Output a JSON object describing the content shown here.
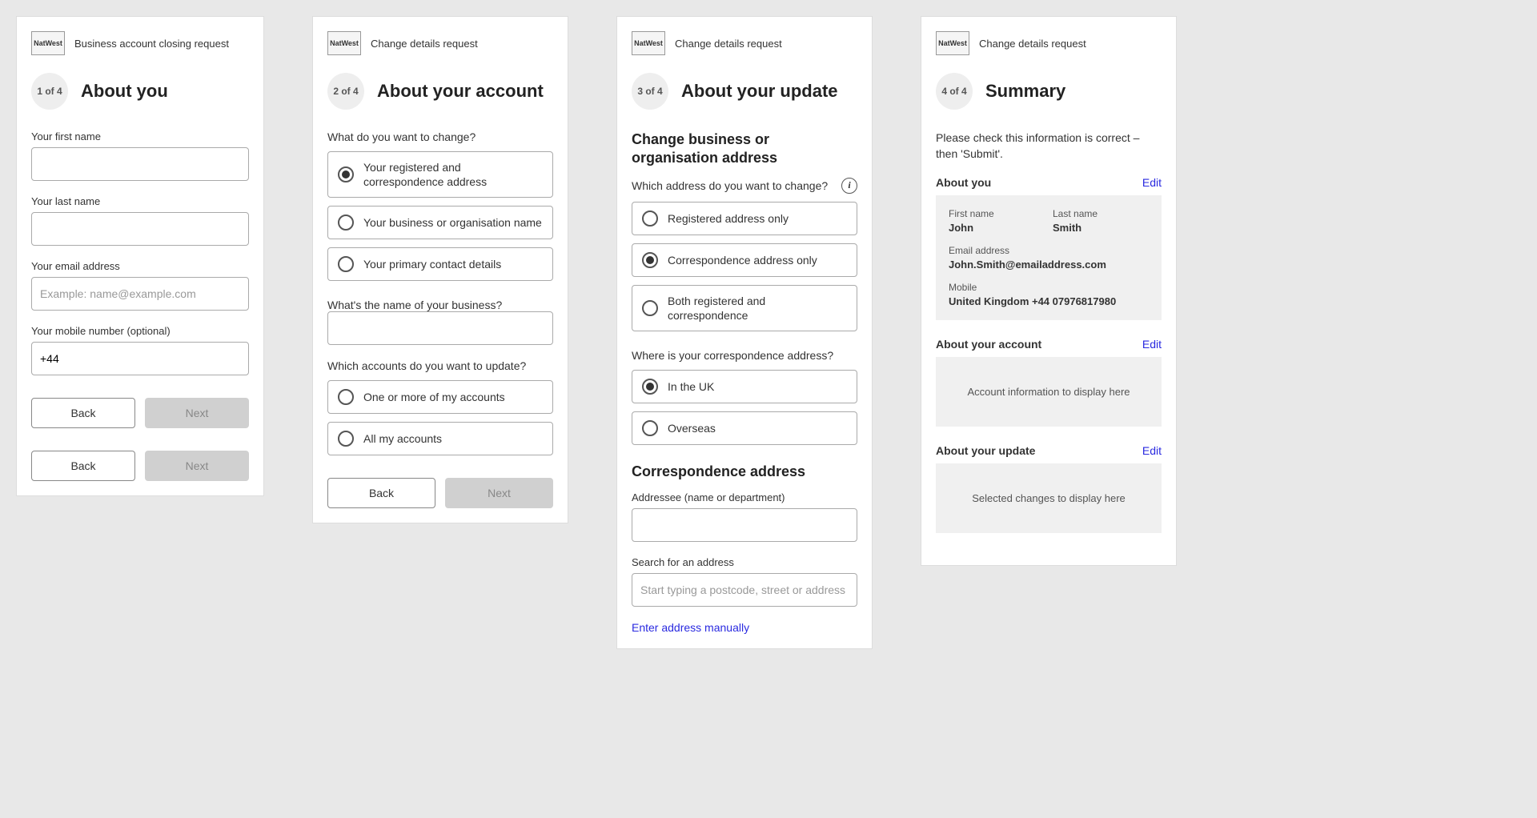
{
  "panel1": {
    "logo": "NatWest",
    "header": "Business account closing request",
    "step": "1 of 4",
    "title": "About you",
    "fields": {
      "first_name": "Your first name",
      "last_name": "Your last name",
      "email": "Your email address",
      "email_placeholder": "Example: name@example.com",
      "mobile": "Your mobile number (optional)",
      "mobile_value": "+44"
    },
    "back": "Back",
    "next": "Next"
  },
  "panel2": {
    "logo": "NatWest",
    "header": "Change details request",
    "step": "2 of 4",
    "title": "About your account",
    "q1": "What do you want to change?",
    "q1_options": {
      "a": "Your registered and correspondence address",
      "b": "Your business or organisation name",
      "c": "Your primary contact details"
    },
    "q2": "What's the name of your business?",
    "q3": "Which accounts do you want to update?",
    "q3_options": {
      "a": "One or more of my accounts",
      "b": "All my accounts"
    },
    "back": "Back",
    "next": "Next"
  },
  "panel3": {
    "logo": "NatWest",
    "header": "Change details request",
    "step": "3 of 4",
    "title": "About your update",
    "section1": "Change business or organisation address",
    "q1": "Which address do you want to change?",
    "q1_options": {
      "a": "Registered address only",
      "b": "Correspondence address only",
      "c": "Both registered and correspondence"
    },
    "q2": "Where is your correspondence address?",
    "q2_options": {
      "a": "In the UK",
      "b": "Overseas"
    },
    "section2": "Correspondence address",
    "addressee": "Addressee (name or department)",
    "search": "Search for an address",
    "search_placeholder": "Start typing a postcode, street or address",
    "manual_link": "Enter address manually"
  },
  "panel4": {
    "logo": "NatWest",
    "header": "Change details request",
    "step": "4 of 4",
    "title": "Summary",
    "intro": "Please check this information is correct – then 'Submit'.",
    "edit": "Edit",
    "sections": {
      "about_you": "About you",
      "about_account": "About your account",
      "about_update": "About your update"
    },
    "you": {
      "first_label": "First name",
      "first_val": "John",
      "last_label": "Last name",
      "last_val": "Smith",
      "email_label": "Email address",
      "email_val": "John.Smith@emailaddress.com",
      "mobile_label": "Mobile",
      "mobile_val": "United Kingdom +44 07976817980"
    },
    "account_placeholder": "Account information to display here",
    "update_placeholder": "Selected changes to display here"
  }
}
